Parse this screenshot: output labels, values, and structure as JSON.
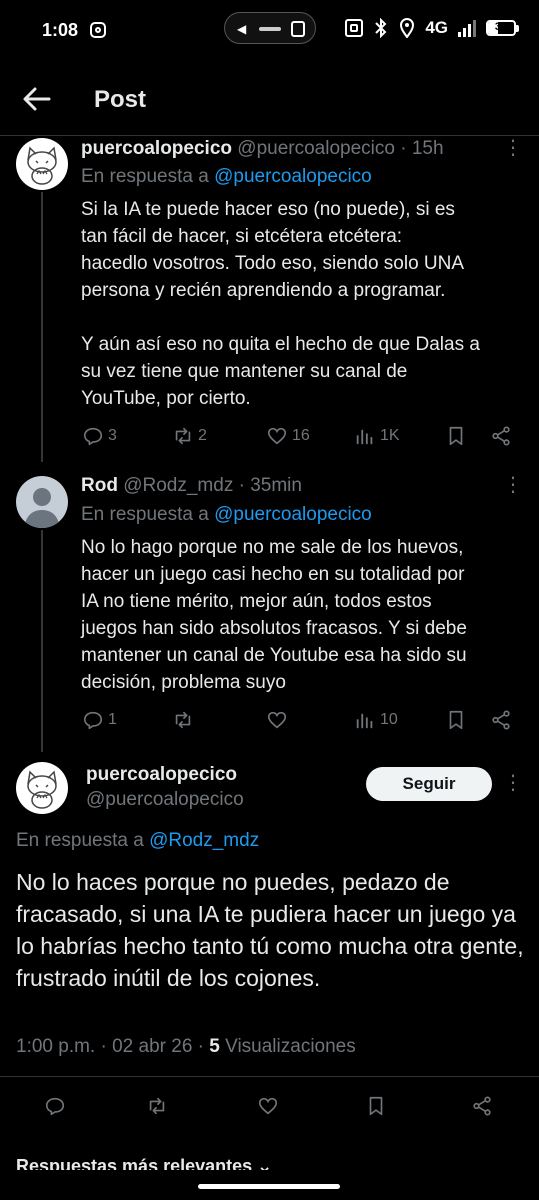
{
  "status_bar": {
    "time": "1:08",
    "network": "4G",
    "battery": "37",
    "battery_level": 0.37
  },
  "header": {
    "title": "Post"
  },
  "tweets": [
    {
      "name": "puercoalopecico",
      "handle": "@puercoalopecico",
      "time": "· 15h",
      "reply_prefix": "En respuesta a ",
      "reply_to": "@puercoalopecico",
      "body": "Si la IA te puede hacer eso (no puede), si es\ntan fácil de hacer, si etcétera etcétera:\nhacedlo vosotros. Todo eso, siendo solo UNA\npersona y recién aprendiendo a programar.\n\nY aún así eso no quita el hecho de que Dalas a\nsu vez tiene que mantener su canal de\nYouTube, por cierto.",
      "replies": "3",
      "reposts": "2",
      "likes": "16",
      "views": "1K"
    },
    {
      "name": "Rod",
      "handle": "@Rodz_mdz",
      "time": "· 35min",
      "reply_prefix": "En respuesta a ",
      "reply_to": "@puercoalopecico",
      "body": "No lo hago porque no me sale de los huevos,\nhacer un juego casi hecho en su totalidad por\nIA no tiene mérito, mejor aún, todos estos\njuegos han sido absolutos fracasos. Y si debe\nmantener un canal de Youtube esa ha sido su\ndecisión, problema suyo",
      "replies": "1",
      "reposts": "",
      "likes": "",
      "views": "10"
    }
  ],
  "main_tweet": {
    "name": "puercoalopecico",
    "handle": "@puercoalopecico",
    "follow_label": "Seguir",
    "reply_prefix": "En respuesta a ",
    "reply_to": "@Rodz_mdz",
    "body": "No lo haces porque no puedes, pedazo de fracasado, si una IA te pudiera hacer un juego ya lo habrías hecho tanto tú como mucha otra gente, frustrado inútil de los cojones.",
    "timestamp": "1:00 p.m. · 02 abr 26 · ",
    "views_count": "5",
    "views_label": " Visualizaciones"
  },
  "replies_section": {
    "label": "Respuestas más relevantes"
  },
  "icons": {
    "back": "back-arrow-icon",
    "more": "more-vertical-icon",
    "reply": "reply-icon",
    "repost": "repost-icon",
    "like": "like-icon",
    "views": "views-icon",
    "bookmark": "bookmark-icon",
    "share": "share-icon"
  },
  "colors": {
    "background": "#000000",
    "text": "#e7e9ea",
    "muted": "#71767b",
    "link": "#1d9bf0",
    "divider": "#2f3336"
  }
}
